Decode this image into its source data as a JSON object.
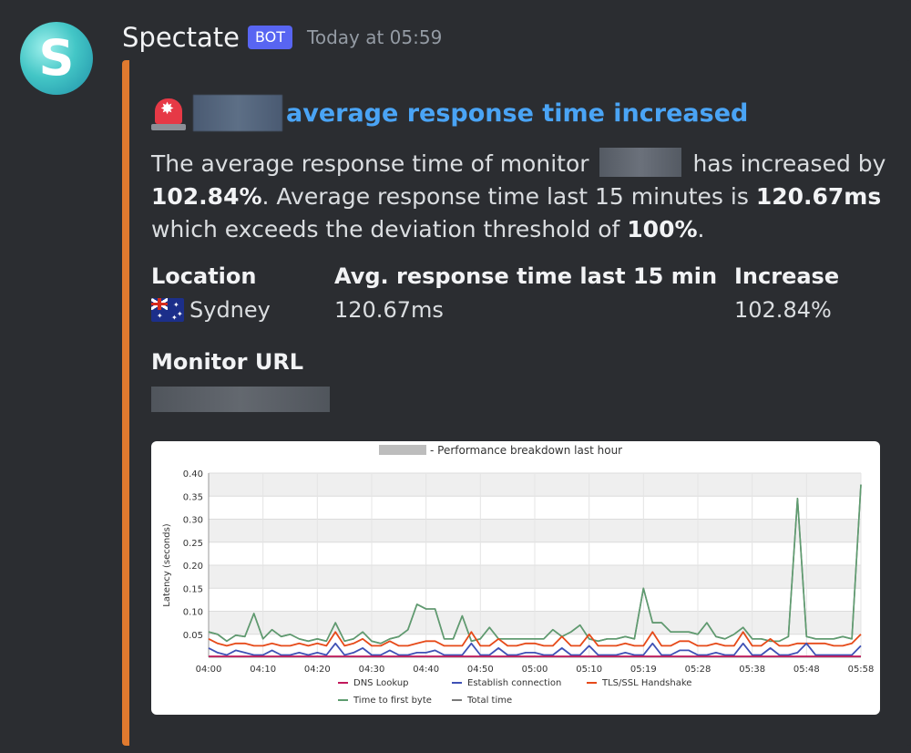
{
  "message": {
    "author": "Spectate",
    "avatar_letter": "S",
    "bot_tag": "BOT",
    "timestamp": "Today at 05:59"
  },
  "embed": {
    "accent_color": "#e07a2f",
    "title_icon": "rotating-light-icon",
    "title": "average response time increased",
    "description": {
      "p1": "The average response time of monitor",
      "p2": "has increased by",
      "pct": "102.84%",
      "p3": ". Average response time last 15 minutes is",
      "avg": "120.67ms",
      "p4": "which exceeds the deviation threshold of",
      "threshold": "100%",
      "p5": "."
    },
    "fields": [
      {
        "name": "Location",
        "value": "Sydney",
        "icon": "australia-flag-icon"
      },
      {
        "name": "Avg. response time last 15 min",
        "value": "120.67ms"
      },
      {
        "name": "Increase",
        "value": "102.84%"
      }
    ],
    "url_field_name": "Monitor URL"
  },
  "chart_data": {
    "type": "line",
    "title": "- Performance breakdown last hour",
    "xlabel": "",
    "ylabel": "Latency (seconds)",
    "ylim": [
      0,
      0.4
    ],
    "yticks": [
      "0.05",
      "0.10",
      "0.15",
      "0.20",
      "0.25",
      "0.30",
      "0.35",
      "0.40"
    ],
    "xticks": [
      "04:00",
      "04:10",
      "04:20",
      "04:30",
      "04:40",
      "04:50",
      "05:00",
      "05:10",
      "05:19",
      "05:28",
      "05:38",
      "05:48",
      "05:58"
    ],
    "xtick_positions": [
      0,
      6,
      12,
      18,
      24,
      30,
      36,
      42,
      48,
      54,
      60,
      66,
      72
    ],
    "grid": true,
    "legend_position": "bottom",
    "series": [
      {
        "name": "DNS Lookup",
        "color": "#c2185b",
        "values": [
          0.002,
          0.002,
          0.002,
          0.002,
          0.002,
          0.002,
          0.002,
          0.002,
          0.002,
          0.002,
          0.002,
          0.002,
          0.002,
          0.002,
          0.002,
          0.002,
          0.002,
          0.002,
          0.002,
          0.002,
          0.002,
          0.002,
          0.002,
          0.002,
          0.002,
          0.002,
          0.002,
          0.002,
          0.002,
          0.002,
          0.002,
          0.002,
          0.002,
          0.002,
          0.002,
          0.002,
          0.002,
          0.002,
          0.002,
          0.002,
          0.002,
          0.002,
          0.002,
          0.002,
          0.002,
          0.002,
          0.002,
          0.002,
          0.002,
          0.002,
          0.002,
          0.002,
          0.002,
          0.002,
          0.002,
          0.002,
          0.002,
          0.002,
          0.002,
          0.002,
          0.002,
          0.002,
          0.002,
          0.002,
          0.002,
          0.002,
          0.002,
          0.002,
          0.002,
          0.002,
          0.002,
          0.002,
          0.002
        ]
      },
      {
        "name": "Establish connection",
        "color": "#3f51b5",
        "values": [
          0.02,
          0.01,
          0.005,
          0.015,
          0.01,
          0.005,
          0.005,
          0.015,
          0.005,
          0.005,
          0.01,
          0.005,
          0.01,
          0.005,
          0.03,
          0.005,
          0.01,
          0.02,
          0.005,
          0.005,
          0.015,
          0.005,
          0.005,
          0.01,
          0.01,
          0.015,
          0.005,
          0.005,
          0.005,
          0.03,
          0.005,
          0.005,
          0.02,
          0.005,
          0.005,
          0.01,
          0.01,
          0.005,
          0.005,
          0.02,
          0.005,
          0.005,
          0.025,
          0.005,
          0.005,
          0.005,
          0.01,
          0.005,
          0.005,
          0.03,
          0.005,
          0.005,
          0.015,
          0.015,
          0.005,
          0.005,
          0.01,
          0.005,
          0.005,
          0.03,
          0.005,
          0.005,
          0.02,
          0.005,
          0.005,
          0.01,
          0.03,
          0.005,
          0.005,
          0.005,
          0.005,
          0.005,
          0.025
        ]
      },
      {
        "name": "TLS/SSL Handshake",
        "color": "#e64a19",
        "values": [
          0.04,
          0.03,
          0.025,
          0.03,
          0.03,
          0.025,
          0.025,
          0.03,
          0.025,
          0.025,
          0.03,
          0.025,
          0.03,
          0.025,
          0.055,
          0.025,
          0.03,
          0.04,
          0.025,
          0.025,
          0.035,
          0.025,
          0.025,
          0.03,
          0.035,
          0.035,
          0.025,
          0.025,
          0.025,
          0.055,
          0.025,
          0.025,
          0.04,
          0.025,
          0.025,
          0.03,
          0.03,
          0.025,
          0.025,
          0.045,
          0.025,
          0.025,
          0.05,
          0.025,
          0.025,
          0.025,
          0.03,
          0.025,
          0.025,
          0.055,
          0.025,
          0.025,
          0.035,
          0.035,
          0.025,
          0.025,
          0.03,
          0.025,
          0.025,
          0.055,
          0.025,
          0.025,
          0.04,
          0.025,
          0.025,
          0.03,
          0.03,
          0.03,
          0.03,
          0.025,
          0.025,
          0.03,
          0.05
        ]
      },
      {
        "name": "Time to first byte",
        "color": "#5e9c6f",
        "values": [
          0.055,
          0.05,
          0.035,
          0.048,
          0.045,
          0.095,
          0.04,
          0.06,
          0.045,
          0.05,
          0.04,
          0.035,
          0.04,
          0.035,
          0.075,
          0.035,
          0.04,
          0.055,
          0.035,
          0.03,
          0.04,
          0.045,
          0.06,
          0.115,
          0.105,
          0.105,
          0.04,
          0.04,
          0.09,
          0.035,
          0.04,
          0.065,
          0.04,
          0.04,
          0.04,
          0.04,
          0.04,
          0.04,
          0.06,
          0.045,
          0.055,
          0.07,
          0.04,
          0.035,
          0.04,
          0.04,
          0.045,
          0.04,
          0.15,
          0.075,
          0.075,
          0.055,
          0.055,
          0.055,
          0.05,
          0.075,
          0.045,
          0.04,
          0.05,
          0.065,
          0.04,
          0.04,
          0.035,
          0.035,
          0.045,
          0.345,
          0.045,
          0.04,
          0.04,
          0.04,
          0.045,
          0.04,
          0.375
        ]
      },
      {
        "name": "Total time",
        "color": "#7a7a7a",
        "values": [
          0.055,
          0.05,
          0.035,
          0.048,
          0.045,
          0.095,
          0.04,
          0.06,
          0.045,
          0.05,
          0.04,
          0.035,
          0.04,
          0.035,
          0.075,
          0.035,
          0.04,
          0.055,
          0.035,
          0.03,
          0.04,
          0.045,
          0.06,
          0.115,
          0.105,
          0.105,
          0.04,
          0.04,
          0.09,
          0.035,
          0.04,
          0.065,
          0.04,
          0.04,
          0.04,
          0.04,
          0.04,
          0.04,
          0.06,
          0.045,
          0.055,
          0.07,
          0.04,
          0.035,
          0.04,
          0.04,
          0.045,
          0.04,
          0.15,
          0.075,
          0.075,
          0.055,
          0.055,
          0.055,
          0.05,
          0.075,
          0.045,
          0.04,
          0.05,
          0.065,
          0.04,
          0.04,
          0.035,
          0.035,
          0.045,
          0.345,
          0.045,
          0.04,
          0.04,
          0.04,
          0.045,
          0.04,
          0.375
        ]
      }
    ]
  }
}
